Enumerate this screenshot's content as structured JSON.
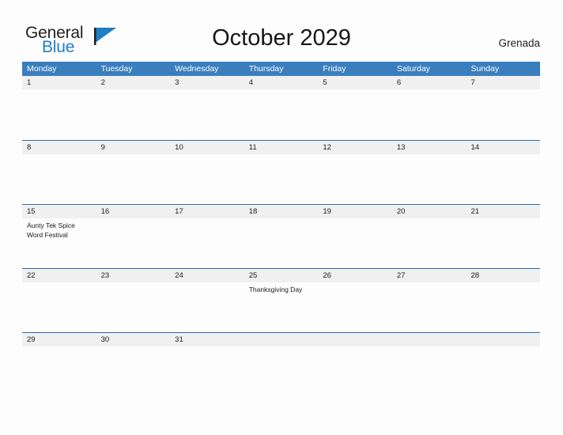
{
  "brand": {
    "name_part1": "General",
    "name_part2": "Blue",
    "flag_icon": "flag-triangle-icon",
    "flag_color": "#1f7ec4"
  },
  "header": {
    "title": "October 2029",
    "country": "Grenada"
  },
  "theme": {
    "header_blue": "#3a7ebe",
    "row_divider_blue": "#2b6ca8",
    "number_band_gray": "#f0f0f0",
    "page_background": "#fdfdfd",
    "text_dark": "#1a1a1a"
  },
  "calendar": {
    "weekdays": [
      "Monday",
      "Tuesday",
      "Wednesday",
      "Thursday",
      "Friday",
      "Saturday",
      "Sunday"
    ],
    "weeks": [
      {
        "days": [
          {
            "number": "1",
            "events": []
          },
          {
            "number": "2",
            "events": []
          },
          {
            "number": "3",
            "events": []
          },
          {
            "number": "4",
            "events": []
          },
          {
            "number": "5",
            "events": []
          },
          {
            "number": "6",
            "events": []
          },
          {
            "number": "7",
            "events": []
          }
        ]
      },
      {
        "days": [
          {
            "number": "8",
            "events": []
          },
          {
            "number": "9",
            "events": []
          },
          {
            "number": "10",
            "events": []
          },
          {
            "number": "11",
            "events": []
          },
          {
            "number": "12",
            "events": []
          },
          {
            "number": "13",
            "events": []
          },
          {
            "number": "14",
            "events": []
          }
        ]
      },
      {
        "days": [
          {
            "number": "15",
            "events": [
              "Aunty Tek Spice Word Festival"
            ]
          },
          {
            "number": "16",
            "events": []
          },
          {
            "number": "17",
            "events": []
          },
          {
            "number": "18",
            "events": []
          },
          {
            "number": "19",
            "events": []
          },
          {
            "number": "20",
            "events": []
          },
          {
            "number": "21",
            "events": []
          }
        ]
      },
      {
        "days": [
          {
            "number": "22",
            "events": []
          },
          {
            "number": "23",
            "events": []
          },
          {
            "number": "24",
            "events": []
          },
          {
            "number": "25",
            "events": [
              "Thanksgiving Day"
            ]
          },
          {
            "number": "26",
            "events": []
          },
          {
            "number": "27",
            "events": []
          },
          {
            "number": "28",
            "events": []
          }
        ]
      },
      {
        "days": [
          {
            "number": "29",
            "events": []
          },
          {
            "number": "30",
            "events": []
          },
          {
            "number": "31",
            "events": []
          },
          {
            "number": "",
            "events": []
          },
          {
            "number": "",
            "events": []
          },
          {
            "number": "",
            "events": []
          },
          {
            "number": "",
            "events": []
          }
        ]
      }
    ]
  }
}
